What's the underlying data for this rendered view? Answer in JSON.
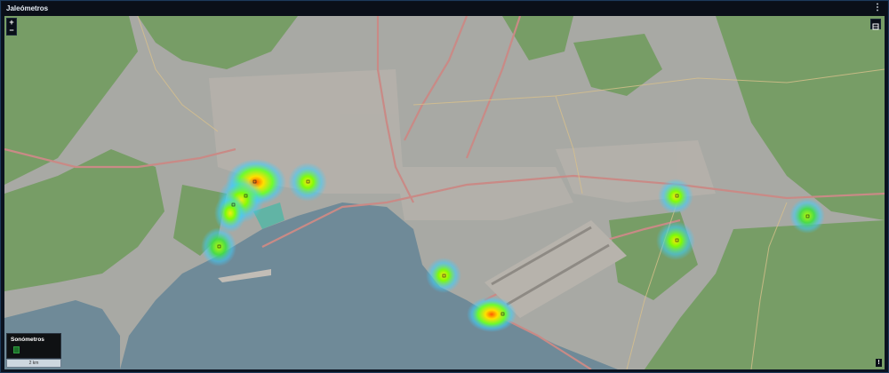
{
  "window": {
    "title": "Jaleómetros",
    "menu_icon": "kebab-menu-icon"
  },
  "map": {
    "zoom_in": "+",
    "zoom_out": "−",
    "layers_icon": "layers-icon",
    "legend": {
      "title": "Sonómetros",
      "swatch_color": "#1c6f2a"
    },
    "scale_label": "2 km",
    "info_icon": "info-icon",
    "heatmap_colors": {
      "low": "#40c8ff",
      "mid": "#7fff00",
      "high": "#ffe000",
      "peak": "#ff4a00"
    }
  }
}
